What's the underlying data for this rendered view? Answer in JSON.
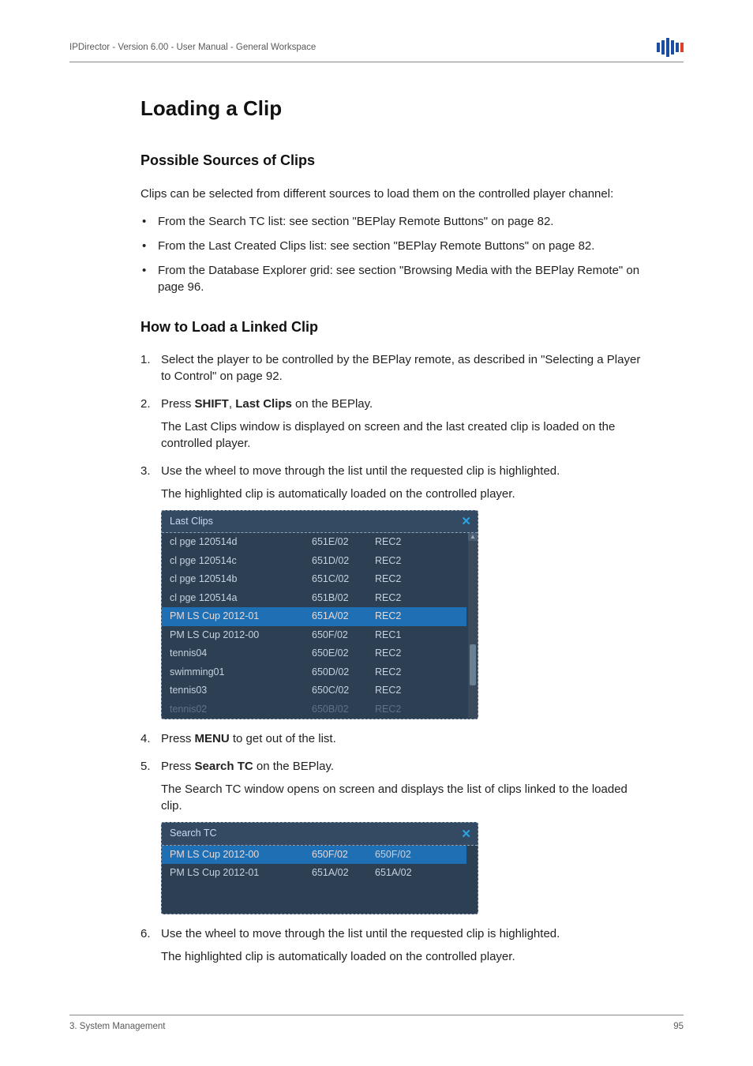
{
  "header": {
    "doc_title": "IPDirector - Version 6.00 - User Manual - General Workspace"
  },
  "footer": {
    "left": "3. System Management",
    "page": "95"
  },
  "section": {
    "title": "Loading a Clip",
    "sub1": {
      "title": "Possible Sources of Clips",
      "intro": "Clips can be selected from different sources to load them on the controlled player channel:",
      "bullets": [
        "From the Search TC list: see section \"BEPlay Remote Buttons\" on page 82.",
        "From the Last Created Clips list: see section \"BEPlay Remote Buttons\" on page 82.",
        "From the Database Explorer grid: see section \"Browsing Media with the BEPlay Remote\" on page 96."
      ]
    },
    "sub2": {
      "title": "How to Load a Linked Clip",
      "steps": {
        "s1": "Select the player to be controlled by the BEPlay remote, as described in \"Selecting a Player to Control\" on page 92.",
        "s2_prefix": "Press ",
        "s2_shift": "SHIFT",
        "s2_sep": ", ",
        "s2_lastclips": "Last Clips",
        "s2_suffix": " on the BEPlay.",
        "s2_sub": "The Last Clips window is displayed on screen and the last created clip is loaded on the controlled player.",
        "s3": "Use the wheel to move through the list until the requested clip is highlighted.",
        "s3_sub": "The highlighted clip is automatically loaded on the controlled player.",
        "s4_prefix": "Press ",
        "s4_menu": "MENU",
        "s4_suffix": " to get out of the list.",
        "s5_prefix": "Press ",
        "s5_search": "Search TC",
        "s5_suffix": " on the BEPlay.",
        "s5_sub": "The Search TC window opens on screen and displays the list of clips linked to the loaded clip.",
        "s6": "Use the wheel to move through the list until the requested clip is highlighted.",
        "s6_sub": "The highlighted clip is automatically loaded on the controlled player."
      }
    }
  },
  "panels": {
    "last_clips": {
      "title": "Last Clips",
      "rows": [
        {
          "name": "cl pge 120514d",
          "code": "651E/02",
          "rec": "REC2",
          "state": "normal"
        },
        {
          "name": "cl pge 120514c",
          "code": "651D/02",
          "rec": "REC2",
          "state": "normal"
        },
        {
          "name": "cl pge 120514b",
          "code": "651C/02",
          "rec": "REC2",
          "state": "normal"
        },
        {
          "name": "cl pge 120514a",
          "code": "651B/02",
          "rec": "REC2",
          "state": "normal"
        },
        {
          "name": "PM LS Cup 2012-01",
          "code": "651A/02",
          "rec": "REC2",
          "state": "highlight"
        },
        {
          "name": "PM LS Cup 2012-00",
          "code": "650F/02",
          "rec": "REC1",
          "state": "normal"
        },
        {
          "name": "tennis04",
          "code": "650E/02",
          "rec": "REC2",
          "state": "normal"
        },
        {
          "name": "swimming01",
          "code": "650D/02",
          "rec": "REC2",
          "state": "normal"
        },
        {
          "name": "tennis03",
          "code": "650C/02",
          "rec": "REC2",
          "state": "normal"
        },
        {
          "name": "tennis02",
          "code": "650B/02",
          "rec": "REC2",
          "state": "dim"
        }
      ]
    },
    "search_tc": {
      "title": "Search TC",
      "rows": [
        {
          "name": "PM LS Cup 2012-00",
          "code": "650F/02",
          "rec": "650F/02",
          "state": "highlight"
        },
        {
          "name": "PM LS Cup 2012-01",
          "code": "651A/02",
          "rec": "651A/02",
          "state": "normal"
        }
      ]
    },
    "close_label": "✕"
  }
}
